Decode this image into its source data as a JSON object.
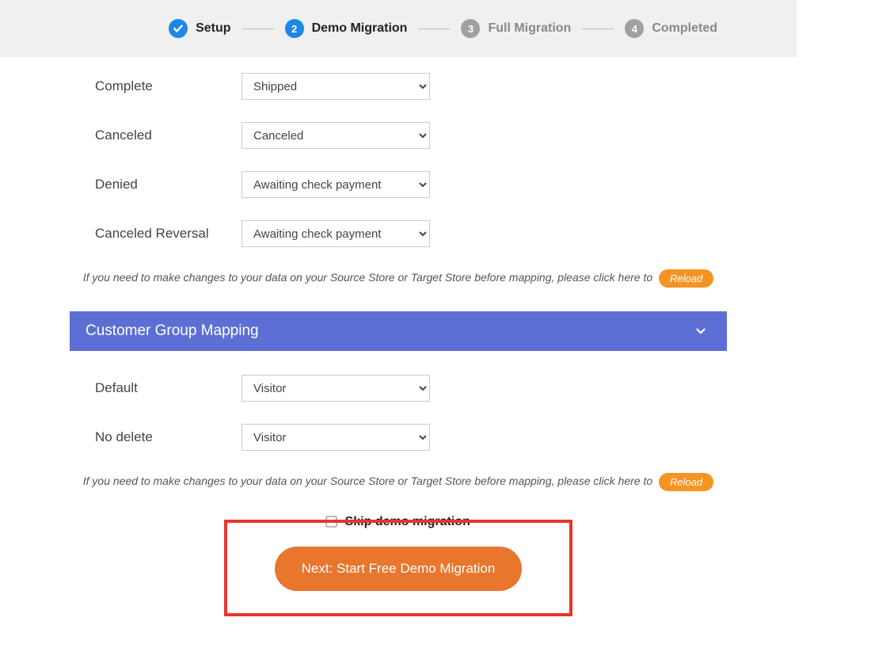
{
  "stepper": {
    "steps": [
      {
        "num": "✓",
        "label": "Setup",
        "state": "active"
      },
      {
        "num": "2",
        "label": "Demo Migration",
        "state": "active"
      },
      {
        "num": "3",
        "label": "Full Migration",
        "state": "inactive"
      },
      {
        "num": "4",
        "label": "Completed",
        "state": "inactive"
      }
    ]
  },
  "order_mapping": {
    "rows": [
      {
        "label": "Complete",
        "value": "Shipped"
      },
      {
        "label": "Canceled",
        "value": "Canceled"
      },
      {
        "label": "Denied",
        "value": "Awaiting check payment"
      },
      {
        "label": "Canceled Reversal",
        "value": "Awaiting check payment"
      }
    ]
  },
  "hint_text": "If you need to make changes to your data on your Source Store or Target Store before mapping, please click here to",
  "reload_label": "Reload",
  "customer_group_header": "Customer Group Mapping",
  "customer_group": {
    "rows": [
      {
        "label": "Default",
        "value": "Visitor"
      },
      {
        "label": "No delete",
        "value": "Visitor"
      }
    ]
  },
  "skip_label": "Skip demo migration",
  "next_button": "Next: Start Free Demo Migration"
}
